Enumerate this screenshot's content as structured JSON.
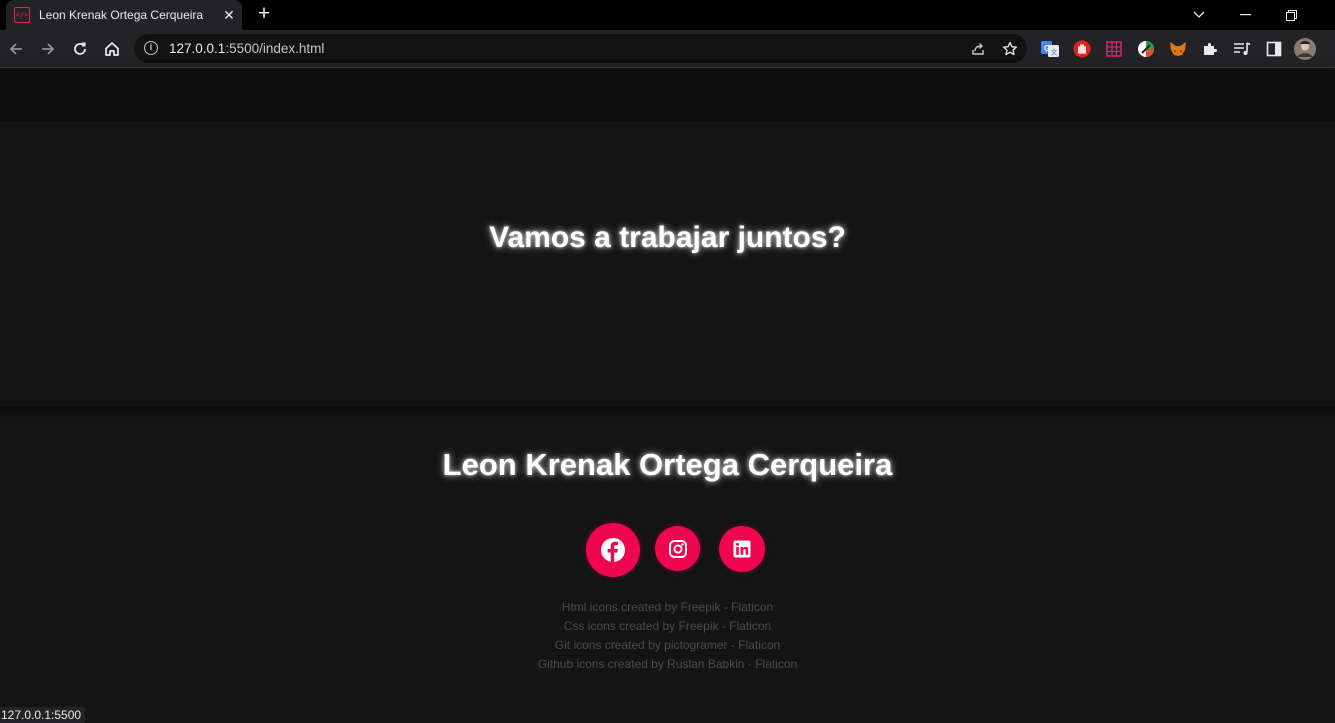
{
  "browser": {
    "tab_title": "Leon Krenak Ortega Cerqueira",
    "tab_close": "✕",
    "new_tab": "+",
    "url_host": "127.0.0.1",
    "url_rest": ":5500/index.html",
    "status_url": "127.0.0.1:5500",
    "window_controls": {
      "list": "⌄",
      "minimize": "—",
      "restore": "❐",
      "close": "✕"
    },
    "extensions": [
      "google-translate-icon",
      "stop-hand-icon",
      "grid-extension-icon",
      "color-wheel-icon",
      "metamask-fox-icon",
      "puzzle-extensions-icon",
      "media-queue-icon",
      "side-panel-icon",
      "profile-avatar"
    ]
  },
  "page": {
    "cta_title": "Vamos a trabajar juntos?",
    "footer_name": "Leon Krenak Ortega Cerqueira",
    "social": [
      {
        "name": "facebook",
        "color": "#f0054f"
      },
      {
        "name": "instagram",
        "color": "#f0054f"
      },
      {
        "name": "linkedin",
        "color": "#f0054f"
      }
    ],
    "credits": [
      "Html icons created by Freepik - Flaticon",
      "Css icons created by Freepik - Flaticon",
      "Git icons created by pictogramer - Flaticon",
      "Github icons created by Ruslan Babkin - Flaticon"
    ]
  },
  "colors": {
    "accent": "#f0054f",
    "page_background": "#141415",
    "browser_frame": "#000000",
    "toolbar": "#232325"
  }
}
